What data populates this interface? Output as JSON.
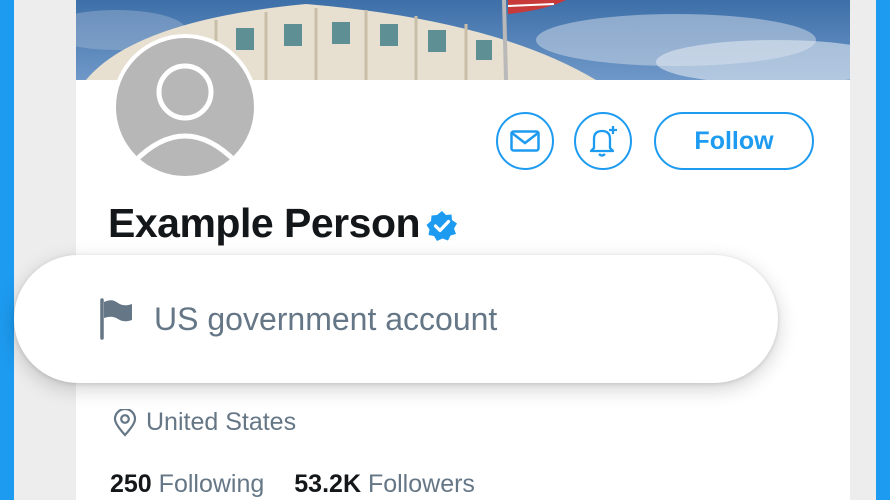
{
  "profile": {
    "name": "Example Person",
    "verified": true,
    "location": "United States",
    "following_count": "250",
    "following_label": "Following",
    "followers_count": "53.2K",
    "followers_label": "Followers"
  },
  "actions": {
    "follow_label": "Follow",
    "message_icon": "envelope-icon",
    "notify_icon": "bell-plus-icon"
  },
  "label_popup": {
    "text": "US government account",
    "icon": "flag-icon"
  },
  "colors": {
    "accent": "#1d9bf0",
    "text_primary": "#14171a",
    "text_secondary": "#657786",
    "avatar_placeholder": "#b7b7b7"
  }
}
